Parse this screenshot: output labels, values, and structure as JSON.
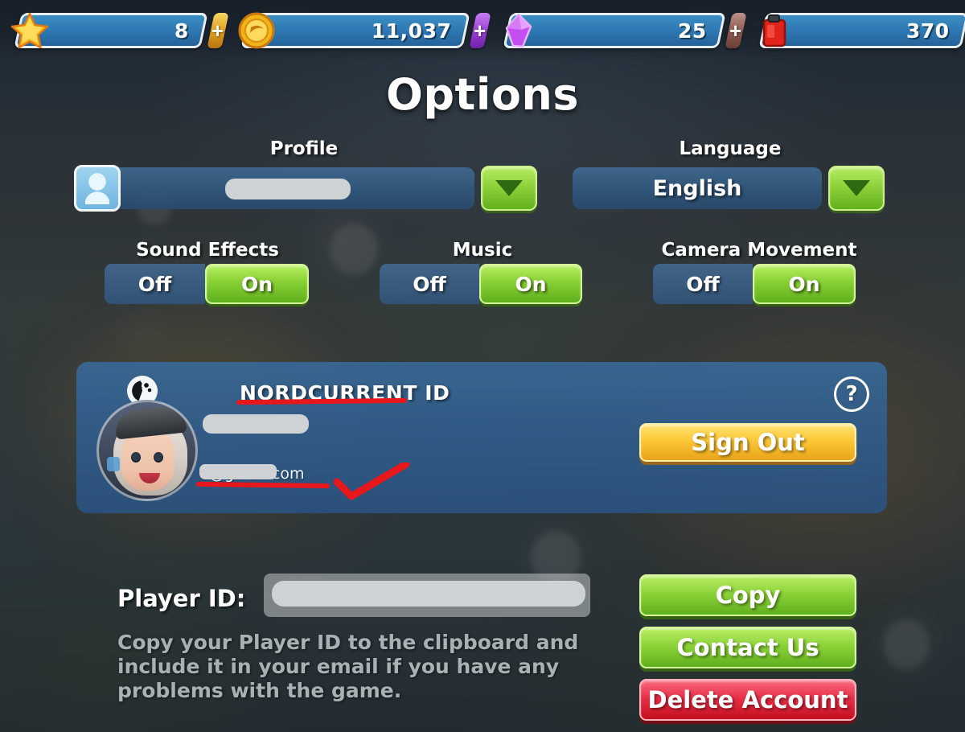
{
  "topbar": {
    "resources": [
      {
        "icon": "star-icon",
        "value": "8",
        "has_plus": true,
        "plus_style": "gold"
      },
      {
        "icon": "coin-icon",
        "value": "11,037",
        "has_plus": true,
        "plus_style": "purple"
      },
      {
        "icon": "gem-icon",
        "value": "25",
        "has_plus": true,
        "plus_style": "red"
      },
      {
        "icon": "fuel-icon",
        "value": "370",
        "has_plus": false,
        "plus_style": ""
      }
    ],
    "plus_label": "+"
  },
  "page_title": "Options",
  "profile": {
    "label": "Profile",
    "value": "",
    "avatar_icon": "user-silhouette-icon",
    "dropdown_icon": "chevron-down-icon"
  },
  "language": {
    "label": "Language",
    "value": "English",
    "dropdown_icon": "chevron-down-icon"
  },
  "toggles": [
    {
      "label": "Sound Effects",
      "off_label": "Off",
      "on_label": "On",
      "selected": "On"
    },
    {
      "label": "Music",
      "off_label": "Off",
      "on_label": "On",
      "selected": "On"
    },
    {
      "label": "Camera Movement",
      "off_label": "Off",
      "on_label": "On",
      "selected": "On"
    }
  ],
  "account": {
    "title": "NORDCURRENT ID",
    "logo_icon": "nordcurrent-logo-icon",
    "avatar_icon": "player-avatar-icon",
    "display_name": "",
    "email": "d@gmail.com",
    "sign_out_label": "Sign Out",
    "help_label": "?",
    "help_icon": "question-mark-icon"
  },
  "player_id": {
    "label": "Player ID:",
    "value": "",
    "helper_text": "Copy your Player ID to the clipboard and include it in your email if you have any problems with the game."
  },
  "actions": {
    "copy_label": "Copy",
    "contact_label": "Contact Us",
    "delete_label": "Delete Account"
  },
  "colors": {
    "accent_green": "#8cd338",
    "accent_gold": "#fcc736",
    "accent_red": "#e63048",
    "panel_blue": "#386896",
    "annotation_red": "#e8171b"
  }
}
